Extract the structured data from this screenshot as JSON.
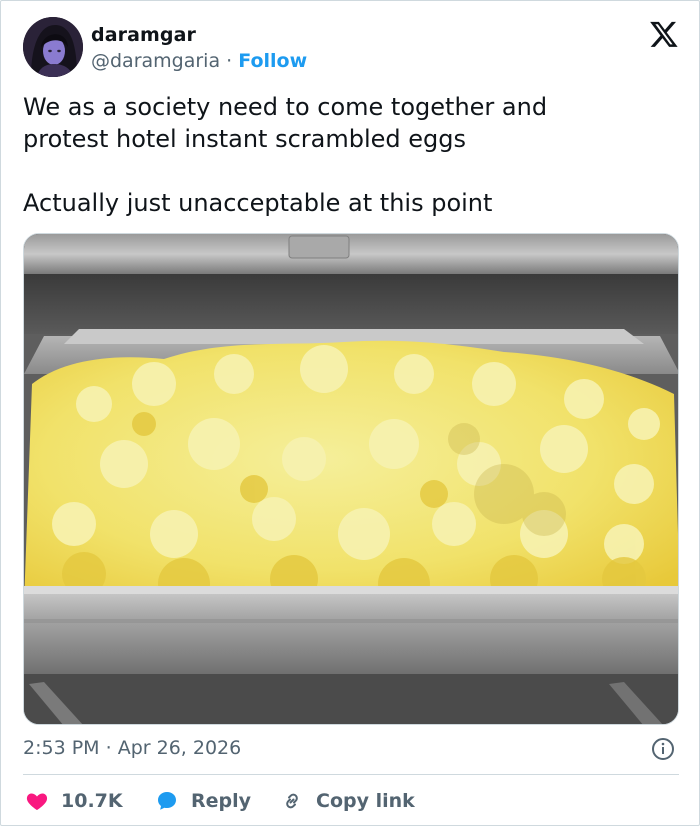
{
  "author": {
    "display_name": "daramgar",
    "handle": "@daramgaria",
    "separator": "·",
    "follow_label": "Follow",
    "avatar_icon": "user-avatar"
  },
  "platform": {
    "logo_icon": "x-logo-icon"
  },
  "tweet": {
    "text": "We as a society need to come together and\nprotest hotel instant scrambled eggs\n\nActually just unacceptable at this point",
    "image_icon": "scrambled-eggs-photo"
  },
  "meta": {
    "time": "2:53 PM",
    "separator": "·",
    "date": "Apr 26, 2026"
  },
  "actions": {
    "like_count": "10.7K",
    "reply_label": "Reply",
    "copy_link_label": "Copy link"
  },
  "colors": {
    "accent": "#1d9bf0",
    "like": "#f91880",
    "secondary_text": "#536471",
    "border": "#cfd9de"
  }
}
